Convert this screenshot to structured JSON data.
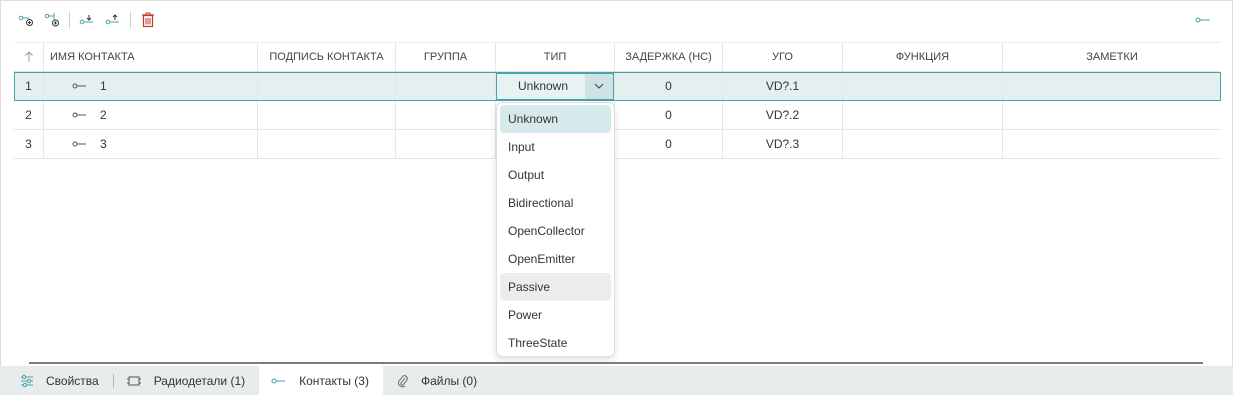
{
  "table": {
    "sort_icon": "sort-up-arrow-icon",
    "columns": [
      "ИМЯ КОНТАКТА",
      "ПОДПИСЬ КОНТАКТА",
      "ГРУППА",
      "ТИП",
      "ЗАДЕРЖКА (НС)",
      "УГО",
      "ФУНКЦИЯ",
      "ЗАМЕТКИ"
    ],
    "rows": [
      {
        "index": "1",
        "name": "1",
        "label": "",
        "group": "",
        "type": "Unknown",
        "delay": "0",
        "ugo": "VD?.1",
        "function": "",
        "notes": ""
      },
      {
        "index": "2",
        "name": "2",
        "label": "",
        "group": "",
        "type": "",
        "delay": "0",
        "ugo": "VD?.2",
        "function": "",
        "notes": ""
      },
      {
        "index": "3",
        "name": "3",
        "label": "",
        "group": "",
        "type": "",
        "delay": "0",
        "ugo": "VD?.3",
        "function": "",
        "notes": ""
      }
    ]
  },
  "dropdown": {
    "options": [
      "Unknown",
      "Input",
      "Output",
      "Bidirectional",
      "OpenCollector",
      "OpenEmitter",
      "Passive",
      "Power",
      "ThreeState"
    ],
    "selected": "Unknown",
    "hovered": "Passive"
  },
  "tabs": [
    {
      "label": "Свойства",
      "icon": "sliders-icon",
      "active": false
    },
    {
      "label": "Радиодетали (1)",
      "icon": "chip-icon",
      "active": false
    },
    {
      "label": "Контакты (3)",
      "icon": "pin-icon",
      "active": true
    },
    {
      "label": "Файлы (0)",
      "icon": "paperclip-icon",
      "active": false
    }
  ],
  "colors": {
    "accent": "#49a3a9",
    "selected_row": "#e4eff0",
    "delete": "#c0392b"
  }
}
